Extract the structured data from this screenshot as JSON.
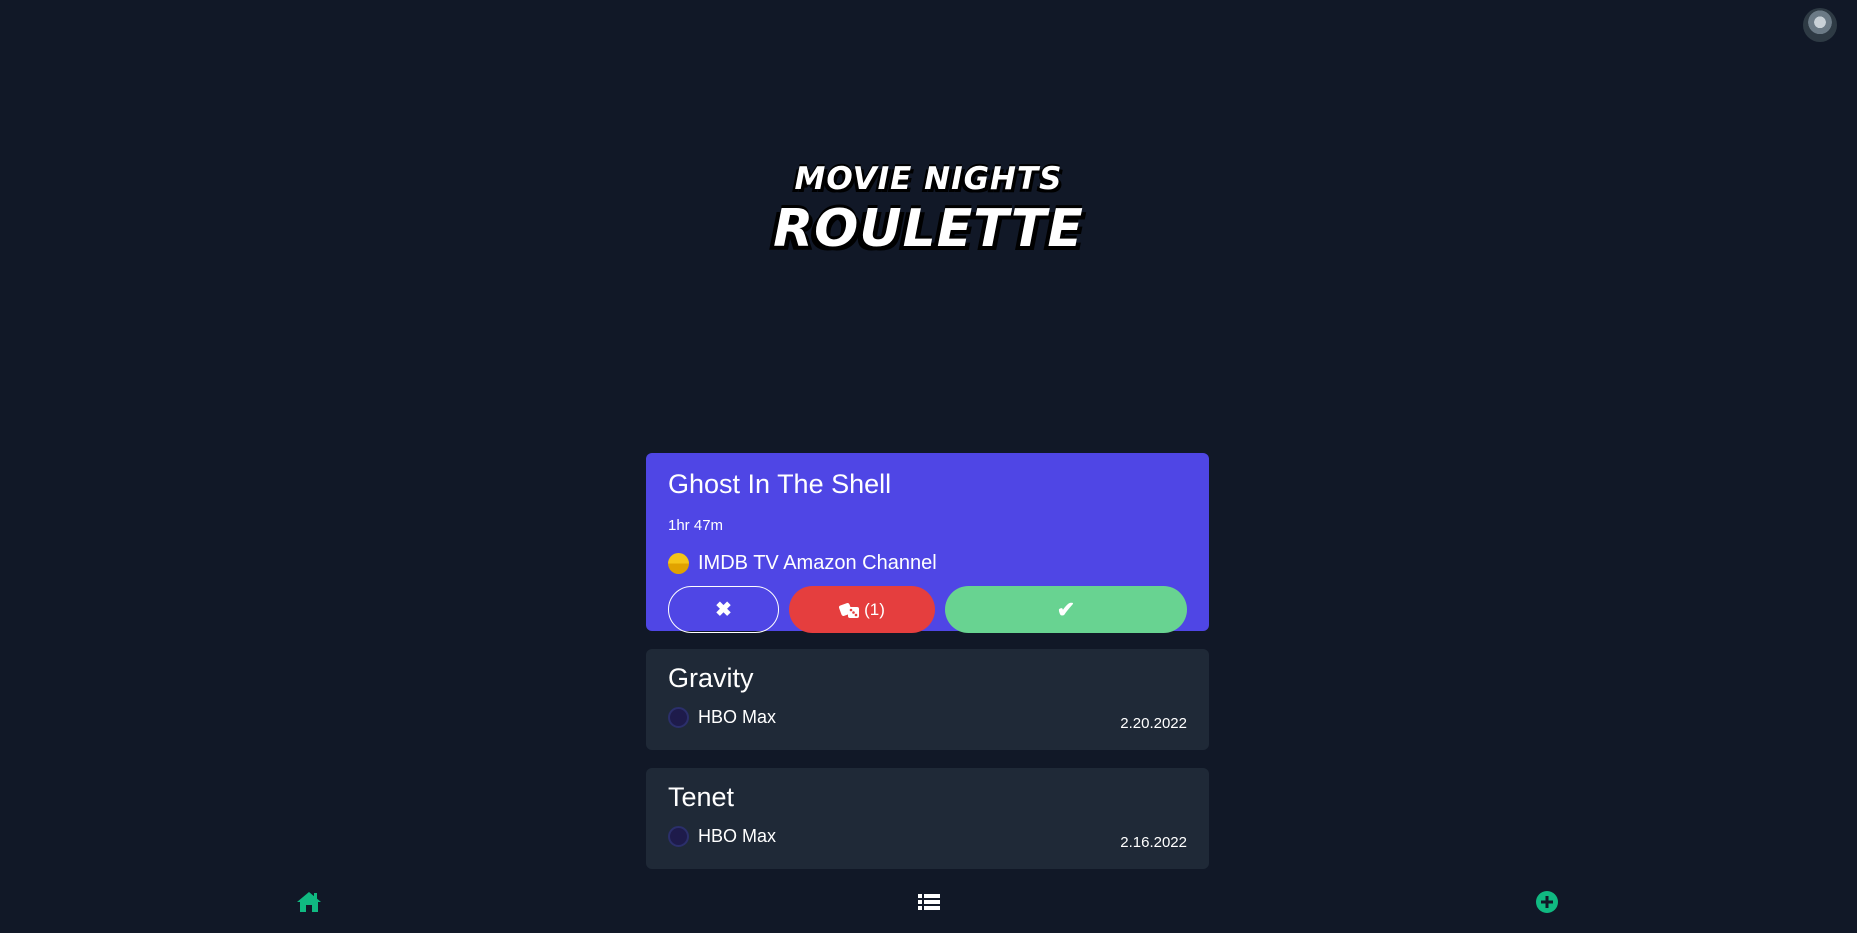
{
  "header": {
    "logo_line1": "MOVIE NIGHTS",
    "logo_line2": "ROULETTE"
  },
  "current_pick": {
    "title": "Ghost In The Shell",
    "runtime": "1hr 47m",
    "provider": "IMDB TV Amazon Channel",
    "reroll_count": "(1)"
  },
  "history": [
    {
      "title": "Gravity",
      "provider": "HBO Max",
      "date": "2.20.2022"
    },
    {
      "title": "Tenet",
      "provider": "HBO Max",
      "date": "2.16.2022"
    }
  ],
  "colors": {
    "background": "#111827",
    "card": "#1f2937",
    "accent": "#4f46e5",
    "reroll": "#e53e3e",
    "accept": "#68d391",
    "nav_icon": "#10b981"
  },
  "nav": {
    "icons": [
      "home-icon",
      "list-icon",
      "add-circle-icon"
    ]
  }
}
